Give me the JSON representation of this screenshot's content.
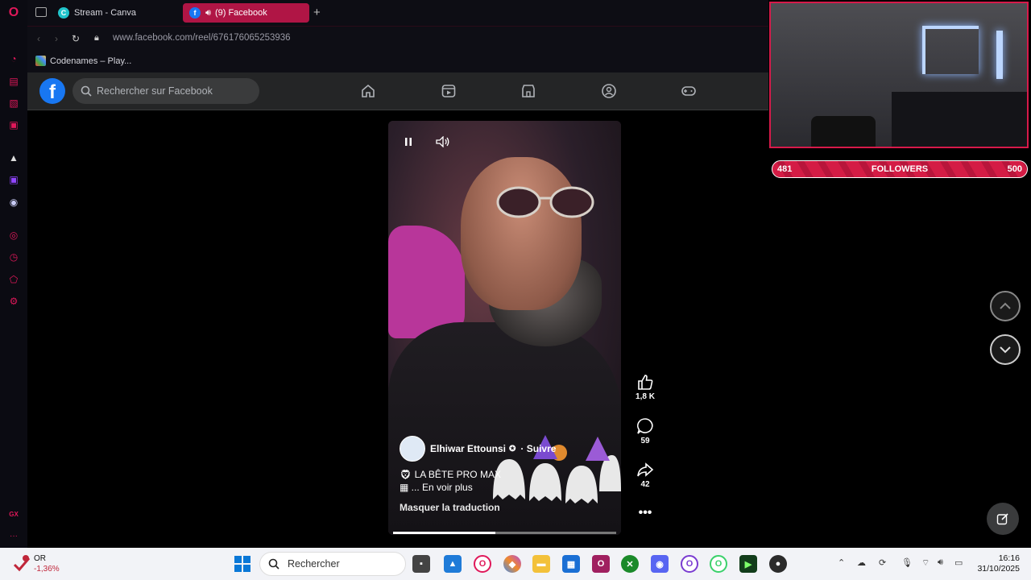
{
  "browser": {
    "tabs": [
      {
        "label": "Stream - Canva",
        "active": false
      },
      {
        "label": "(9) Facebook",
        "active": true
      }
    ],
    "url": "www.facebook.com/reel/676176065253936",
    "bookmarks": [
      {
        "label": "Codenames – Play..."
      }
    ]
  },
  "facebook": {
    "search_placeholder": "Rechercher sur Facebook",
    "nav_icons": [
      "home-icon",
      "video-icon",
      "marketplace-icon",
      "groups-icon",
      "gaming-icon"
    ]
  },
  "reel": {
    "author": "Elhiwar Ettounsi",
    "follow_label": "· Suivre",
    "caption_line1": "LA BÊTE PRO MAX",
    "caption_line2": "... En voir plus",
    "translate_label": "Masquer la traduction",
    "progress": 0.46,
    "likes": "1,8 K",
    "comments": "59",
    "shares": "42"
  },
  "stream_overlay": {
    "followers_current": "481",
    "followers_label": "FOLLOWERS",
    "followers_goal": "500"
  },
  "taskbar": {
    "stock_name": "OR",
    "stock_change": "-1,36%",
    "search_placeholder": "Rechercher",
    "time": "16:16",
    "date": "31/10/2025"
  },
  "colors": {
    "accent": "#e0185a",
    "facebook_blue": "#1877f2",
    "tab_active": "#b01545"
  }
}
